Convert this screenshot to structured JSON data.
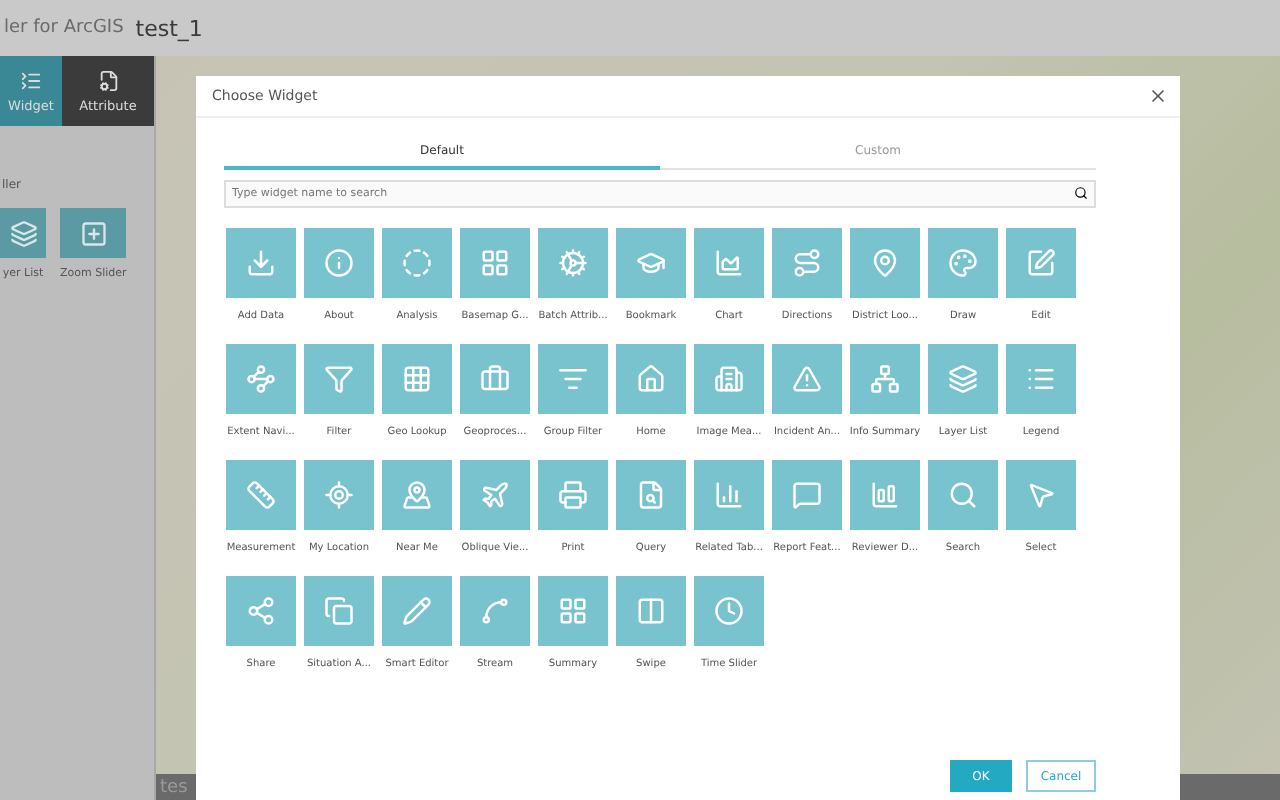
{
  "app_header": {
    "title_fragment": "ler for ArcGIS",
    "app_name": "test_1"
  },
  "side_panel": {
    "tabs": [
      {
        "label": "Widget",
        "selected": true
      },
      {
        "label": "Attribute",
        "selected": false
      }
    ],
    "section_label": "ller",
    "widgets": [
      "yer List",
      "Zoom Slider"
    ]
  },
  "map": {
    "footer_text": "tes"
  },
  "dialog": {
    "title": "Choose Widget",
    "tabs": [
      {
        "label": "Default",
        "selected": true
      },
      {
        "label": "Custom",
        "selected": false
      }
    ],
    "search": {
      "placeholder": "Type widget name to search"
    },
    "widgets": [
      "Add Data",
      "About",
      "Analysis",
      "Basemap G...",
      "Batch Attrib...",
      "Bookmark",
      "Chart",
      "Directions",
      "District Loo...",
      "Draw",
      "Edit",
      "Extent Navi...",
      "Filter",
      "Geo Lookup",
      "Geoproces...",
      "Group Filter",
      "Home",
      "Image Mea...",
      "Incident An...",
      "Info Summary",
      "Layer List",
      "Legend",
      "Measurement",
      "My Location",
      "Near Me",
      "Oblique Vie...",
      "Print",
      "Query",
      "Related Tab...",
      "Report Feat...",
      "Reviewer D...",
      "Search",
      "Select",
      "Share",
      "Situation A...",
      "Smart Editor",
      "Stream",
      "Summary",
      "Swipe",
      "Time Slider"
    ],
    "buttons": {
      "ok": "OK",
      "cancel": "Cancel"
    }
  }
}
